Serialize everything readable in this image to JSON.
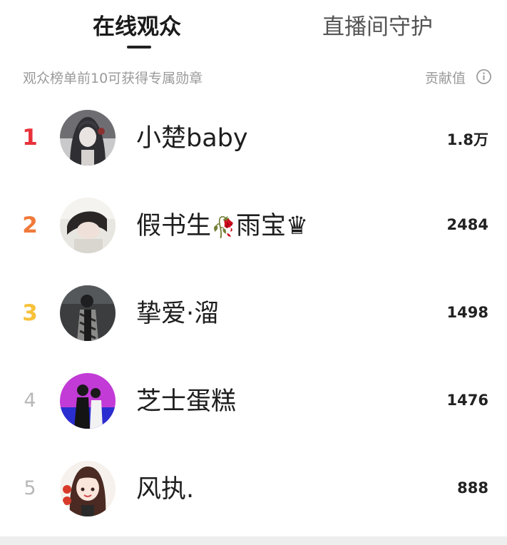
{
  "tabs": [
    {
      "label": "在线观众",
      "active": true
    },
    {
      "label": "直播间守护",
      "active": false
    }
  ],
  "subheader": {
    "left_text": "观众榜单前10可获得专属勋章",
    "right_text": "贡献值",
    "info_icon": "info-circle-icon"
  },
  "colors": {
    "rank1": "#e8323b",
    "rank2": "#f07a3a",
    "rank3": "#f7c23a",
    "rank_other": "#b8b8b8"
  },
  "rows": [
    {
      "rank": "1",
      "name": "小楚baby",
      "name_emoji": "",
      "score": "1.8万"
    },
    {
      "rank": "2",
      "name": "假书生",
      "name_emoji": "🥀",
      "name_tail": "雨宝♛",
      "score": "2484"
    },
    {
      "rank": "3",
      "name": "挚爱·溜",
      "name_emoji": "",
      "score": "1498"
    },
    {
      "rank": "4",
      "name": "芝士蛋糕",
      "name_emoji": "",
      "score": "1476"
    },
    {
      "rank": "5",
      "name": "风执.",
      "name_emoji": "",
      "score": "888"
    }
  ]
}
